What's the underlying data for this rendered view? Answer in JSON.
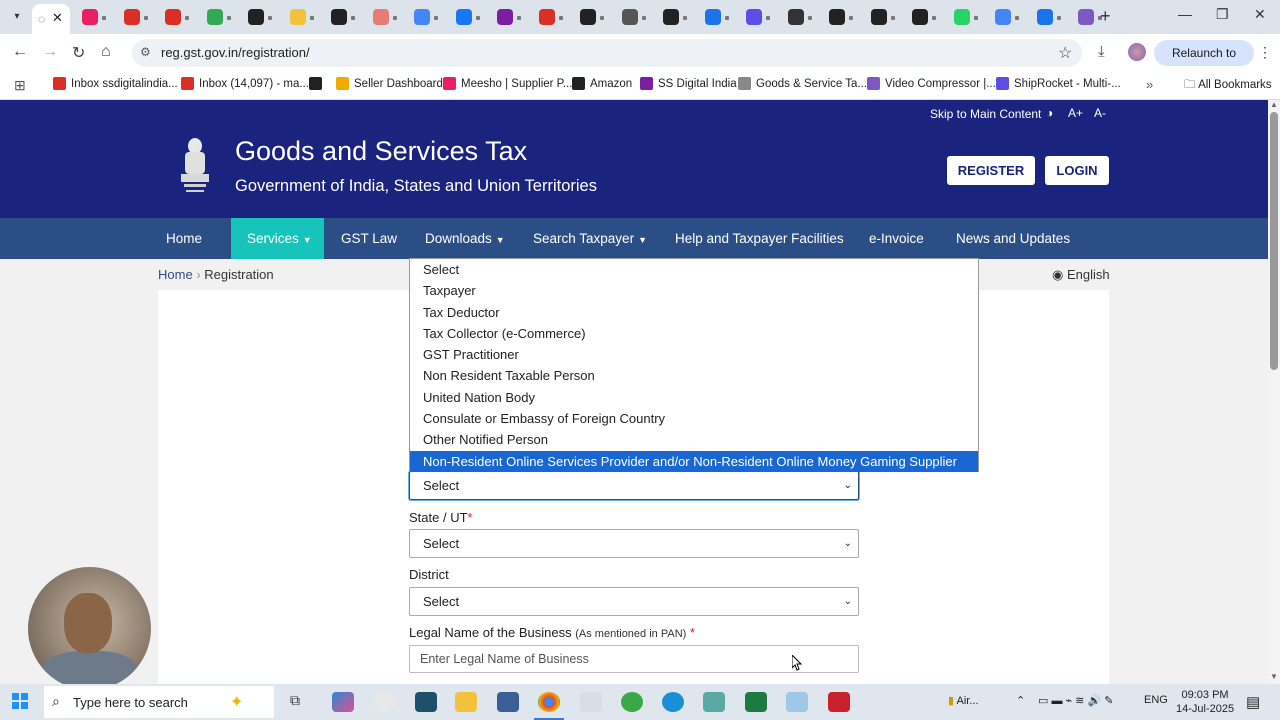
{
  "browser": {
    "url": "reg.gst.gov.in/registration/",
    "relaunch_label": "Relaunch to update",
    "bookmarks": [
      {
        "label": "Inbox ssdigitalindia...",
        "icon": "gmail-icon",
        "color": "#d93025"
      },
      {
        "label": "Inbox (14,097) - ma...",
        "icon": "gmail-icon",
        "color": "#d93025"
      },
      {
        "label": "",
        "icon": "amazon-icon",
        "color": "#222222"
      },
      {
        "label": "Seller Dashboard",
        "icon": "seller-icon",
        "color": "#f2a900"
      },
      {
        "label": "Meesho | Supplier P...",
        "icon": "meesho-icon",
        "color": "#e91e63"
      },
      {
        "label": "Amazon",
        "icon": "amazon-icon",
        "color": "#222222"
      },
      {
        "label": "SS Digital India",
        "icon": "ss-icon",
        "color": "#7b1fa2"
      },
      {
        "label": "Goods & Service Ta...",
        "icon": "gst-icon",
        "color": "#888888"
      },
      {
        "label": "Video Compressor |...",
        "icon": "video-icon",
        "color": "#7e57c2"
      },
      {
        "label": "ShipRocket - Multi-...",
        "icon": "shiprocket-icon",
        "color": "#5c4ee5"
      }
    ],
    "all_bookmarks": "All Bookmarks"
  },
  "header": {
    "skip_link": "Skip to Main Content",
    "font_increase": "A+",
    "font_decrease": "A-",
    "title": "Goods and Services Tax",
    "subtitle": "Government of India, States and Union Territories",
    "register": "REGISTER",
    "login": "LOGIN"
  },
  "nav": {
    "items": [
      {
        "label": "Home",
        "caret": false
      },
      {
        "label": "Services",
        "caret": true
      },
      {
        "label": "GST Law",
        "caret": false
      },
      {
        "label": "Downloads",
        "caret": true
      },
      {
        "label": "Search Taxpayer",
        "caret": true
      },
      {
        "label": "Help and Taxpayer Facilities",
        "caret": false
      },
      {
        "label": "e-Invoice",
        "caret": false
      },
      {
        "label": "News and Updates",
        "caret": false
      }
    ]
  },
  "breadcrumb": {
    "home": "Home",
    "current": "Registration"
  },
  "language": "English",
  "form": {
    "taxpayer_type": {
      "value": "Select",
      "options": [
        "Select",
        "Taxpayer",
        "Tax Deductor",
        "Tax Collector (e-Commerce)",
        "GST Practitioner",
        "Non Resident Taxable Person",
        "United Nation Body",
        "Consulate or Embassy of Foreign Country",
        "Other Notified Person",
        "Non-Resident Online Services Provider and/or Non-Resident Online Money Gaming Supplier"
      ],
      "highlighted_index": 9
    },
    "state_label": "State / UT",
    "state_value": "Select",
    "district_label": "District",
    "district_value": "Select",
    "legal_name_label": "Legal Name of the Business",
    "legal_name_hint": "(As mentioned in PAN)",
    "legal_name_placeholder": "Enter Legal Name of Business",
    "required_marker": "*"
  },
  "taskbar": {
    "search_placeholder": "Type here to search",
    "tray_weather": "Air...",
    "tray_lang": "ENG",
    "time": "09:03 PM",
    "date": "14-Jul-2025"
  },
  "colors": {
    "header_bg": "#1a237e",
    "nav_bg": "#2c4e86",
    "nav_active": "#17c4bb",
    "highlight": "#1967d2"
  }
}
